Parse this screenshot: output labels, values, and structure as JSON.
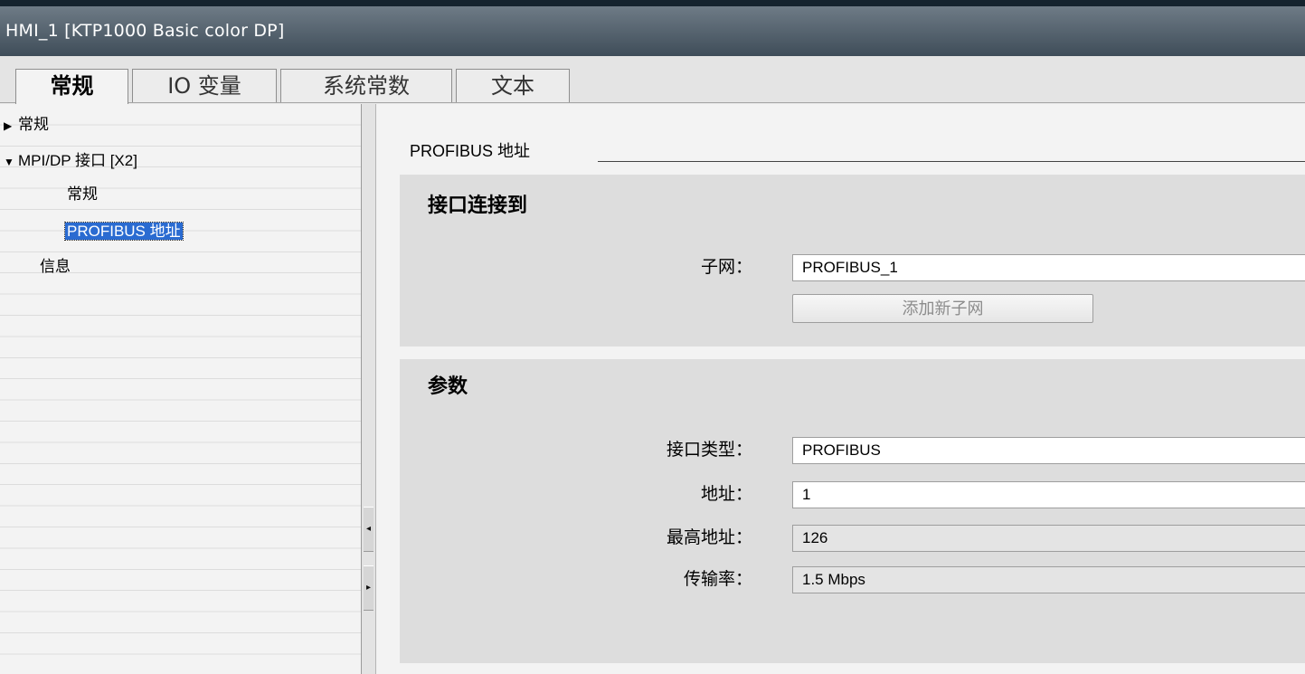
{
  "window": {
    "title": "HMI_1 [KTP1000 Basic color DP]"
  },
  "tabs": [
    {
      "label": "常规",
      "active": true
    },
    {
      "label": "IO 变量",
      "active": false
    },
    {
      "label": "系统常数",
      "active": false
    },
    {
      "label": "文本",
      "active": false
    }
  ],
  "tree": [
    {
      "label": "常规",
      "expander": "▶"
    },
    {
      "label": "MPI/DP 接口 [X2]",
      "expander": "▼"
    },
    {
      "label": "常规",
      "expander": ""
    },
    {
      "label": "PROFIBUS 地址",
      "expander": "",
      "selected": true
    },
    {
      "label": "信息",
      "expander": ""
    }
  ],
  "splitter": {
    "collapse_glyph": "◂",
    "expand_glyph": "▸"
  },
  "section": {
    "title": "PROFIBUS 地址"
  },
  "interface_group": {
    "title": "接口连接到",
    "subnet_label": "子网：",
    "subnet_value": "PROFIBUS_1",
    "add_subnet_label": "添加新子网"
  },
  "params_group": {
    "title": "参数",
    "interface_type_label": "接口类型：",
    "interface_type_value": "PROFIBUS",
    "address_label": "地址：",
    "address_value": "1",
    "highest_address_label": "最高地址：",
    "highest_address_value": "126",
    "baud_rate_label": "传输率：",
    "baud_rate_value": "1.5 Mbps"
  }
}
